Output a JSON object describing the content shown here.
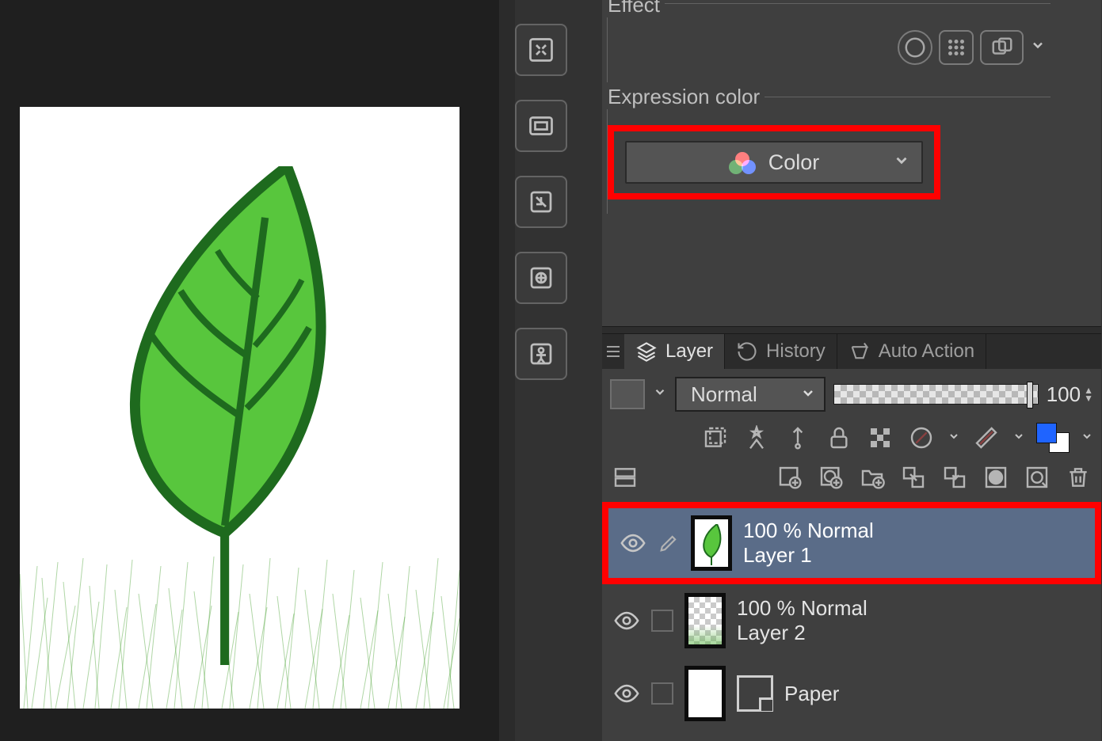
{
  "properties": {
    "effect_label": "Effect",
    "expression_label": "Expression color",
    "expression_value": "Color"
  },
  "tabs": {
    "layer": "Layer",
    "history": "History",
    "auto_action": "Auto Action"
  },
  "layer_panel": {
    "blend_mode": "Normal",
    "opacity": "100"
  },
  "layers": [
    {
      "info": "100 % Normal",
      "name": "Layer 1"
    },
    {
      "info": "100 % Normal",
      "name": "Layer 2"
    },
    {
      "info": "",
      "name": "Paper"
    }
  ]
}
